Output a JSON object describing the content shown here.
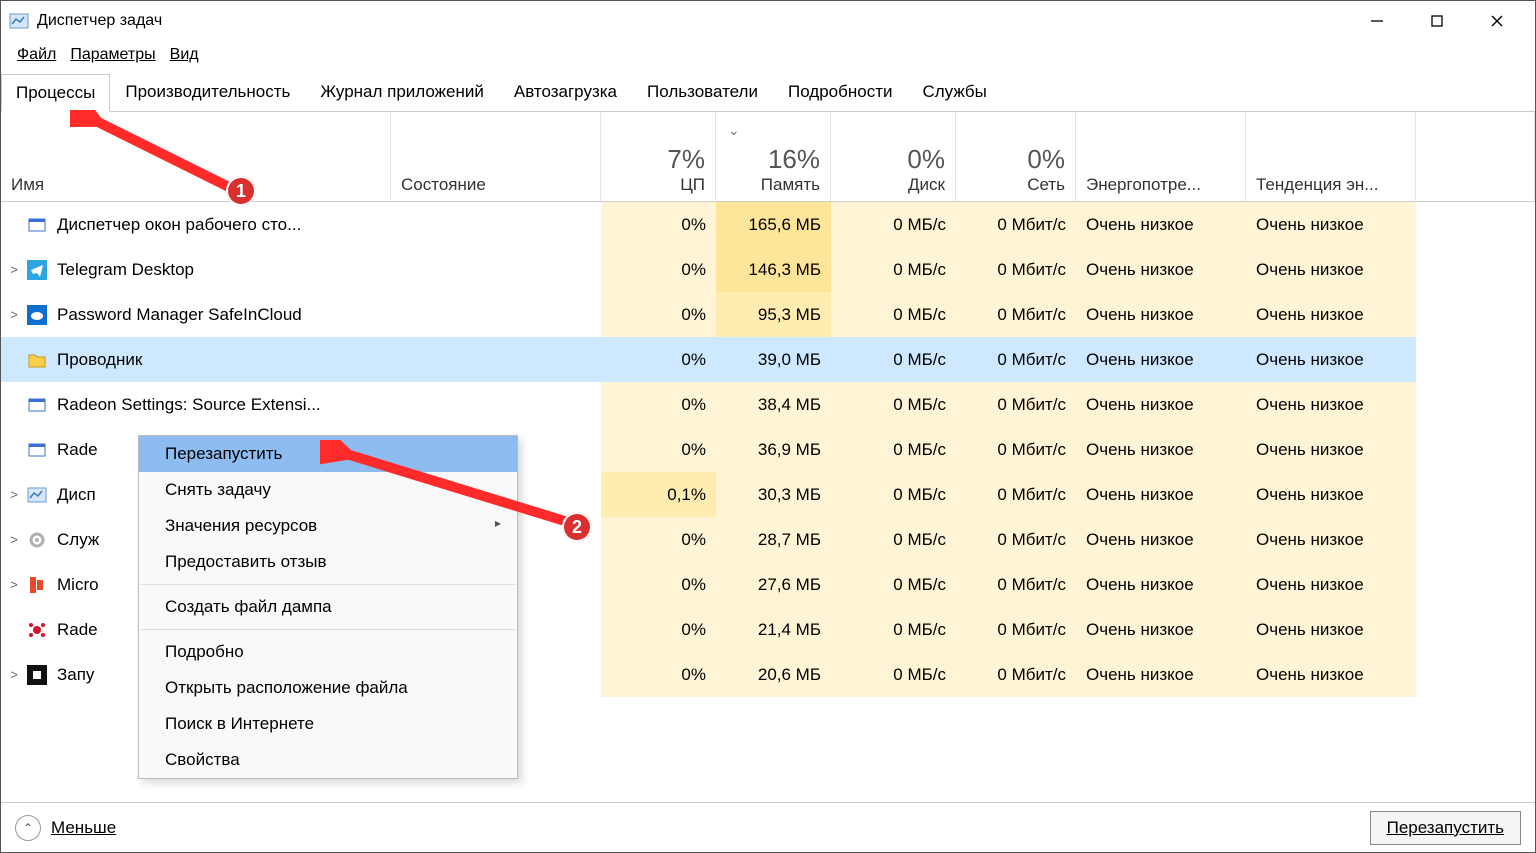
{
  "title": "Диспетчер задач",
  "window_controls": {
    "min": "—",
    "max": "☐",
    "close": "✕"
  },
  "menu": [
    "Файл",
    "Параметры",
    "Вид"
  ],
  "tabs": [
    "Процессы",
    "Производительность",
    "Журнал приложений",
    "Автозагрузка",
    "Пользователи",
    "Подробности",
    "Службы"
  ],
  "active_tab": 0,
  "header": {
    "name": "Имя",
    "status": "Состояние",
    "cpu": {
      "pct": "7%",
      "label": "ЦП"
    },
    "mem": {
      "pct": "16%",
      "label": "Память",
      "sorted": true
    },
    "disk": {
      "pct": "0%",
      "label": "Диск"
    },
    "net": {
      "pct": "0%",
      "label": "Сеть"
    },
    "power": "Энергопотре...",
    "trend": "Тенденция эн..."
  },
  "rows": [
    {
      "exp": "",
      "icon": "window-icon",
      "name": "Диспетчер окон рабочего сто...",
      "cpu": "0%",
      "mem": "165,6 МБ",
      "memlvl": "heavy2",
      "disk": "0 МБ/с",
      "net": "0 Мбит/с",
      "power": "Очень низкое",
      "trend": "Очень низкое"
    },
    {
      "exp": ">",
      "icon": "telegram-icon",
      "name": "Telegram Desktop",
      "cpu": "0%",
      "mem": "146,3 МБ",
      "memlvl": "heavy2",
      "disk": "0 МБ/с",
      "net": "0 Мбит/с",
      "power": "Очень низкое",
      "trend": "Очень низкое"
    },
    {
      "exp": ">",
      "icon": "safeincloud-icon",
      "name": "Password Manager SafeInCloud",
      "cpu": "0%",
      "mem": "95,3 МБ",
      "memlvl": "heavy1",
      "disk": "0 МБ/с",
      "net": "0 Мбит/с",
      "power": "Очень низкое",
      "trend": "Очень низкое"
    },
    {
      "exp": "",
      "icon": "explorer-icon",
      "name": "Проводник",
      "cpu": "0%",
      "mem": "39,0 МБ",
      "memlvl": "",
      "disk": "0 МБ/с",
      "net": "0 Мбит/с",
      "power": "Очень низкое",
      "trend": "Очень низкое",
      "selected": true
    },
    {
      "exp": "",
      "icon": "window-icon",
      "name": "Radeon Settings: Source Extensi...",
      "cpu": "0%",
      "mem": "38,4 МБ",
      "memlvl": "",
      "disk": "0 МБ/с",
      "net": "0 Мбит/с",
      "power": "Очень низкое",
      "trend": "Очень низкое"
    },
    {
      "exp": "",
      "icon": "window-icon",
      "name": "Rade",
      "cpu": "0%",
      "mem": "36,9 МБ",
      "memlvl": "",
      "disk": "0 МБ/с",
      "net": "0 Мбит/с",
      "power": "Очень низкое",
      "trend": "Очень низкое"
    },
    {
      "exp": ">",
      "icon": "taskmgr-icon",
      "name": "Дисп",
      "cpu": "0,1%",
      "cpulvl": "slight",
      "mem": "30,3 МБ",
      "memlvl": "",
      "disk": "0 МБ/с",
      "net": "0 Мбит/с",
      "power": "Очень низкое",
      "trend": "Очень низкое"
    },
    {
      "exp": ">",
      "icon": "gear-icon",
      "name": "Служ",
      "cpu": "0%",
      "mem": "28,7 МБ",
      "memlvl": "",
      "disk": "0 МБ/с",
      "net": "0 Мбит/с",
      "power": "Очень низкое",
      "trend": "Очень низкое"
    },
    {
      "exp": ">",
      "icon": "office-icon",
      "name": "Micro",
      "cpu": "0%",
      "mem": "27,6 МБ",
      "memlvl": "",
      "disk": "0 МБ/с",
      "net": "0 Мбит/с",
      "power": "Очень низкое",
      "trend": "Очень низкое"
    },
    {
      "exp": "",
      "icon": "radeon-icon",
      "name": "Rade",
      "cpu": "0%",
      "mem": "21,4 МБ",
      "memlvl": "",
      "disk": "0 МБ/с",
      "net": "0 Мбит/с",
      "power": "Очень низкое",
      "trend": "Очень низкое"
    },
    {
      "exp": ">",
      "icon": "black-icon",
      "name": "Запу",
      "cpu": "0%",
      "mem": "20,6 МБ",
      "memlvl": "",
      "disk": "0 МБ/с",
      "net": "0 Мбит/с",
      "power": "Очень низкое",
      "trend": "Очень низкое"
    }
  ],
  "context_menu": [
    {
      "label": "Перезапустить",
      "hover": true
    },
    {
      "label": "Снять задачу"
    },
    {
      "label": "Значения ресурсов",
      "submenu": true
    },
    {
      "label": "Предоставить отзыв"
    },
    {
      "sep": true
    },
    {
      "label": "Создать файл дампа"
    },
    {
      "sep": true
    },
    {
      "label": "Подробно"
    },
    {
      "label": "Открыть расположение файла"
    },
    {
      "label": "Поиск в Интернете"
    },
    {
      "label": "Свойства"
    }
  ],
  "statusbar": {
    "less": "Меньше",
    "restart": "Перезапустить"
  },
  "annotations": {
    "badge1": "1",
    "badge2": "2"
  },
  "icons": {
    "window-icon": "#3b6fd6",
    "telegram-icon": "#2ca5e0",
    "safeincloud-icon": "#0d6ecf",
    "explorer-icon": "#ffcf4a",
    "taskmgr-icon": "#7aa4d6",
    "gear-icon": "#b0b0b0",
    "office-icon": "#e84a27",
    "radeon-icon": "#d6132a",
    "black-icon": "#111"
  }
}
